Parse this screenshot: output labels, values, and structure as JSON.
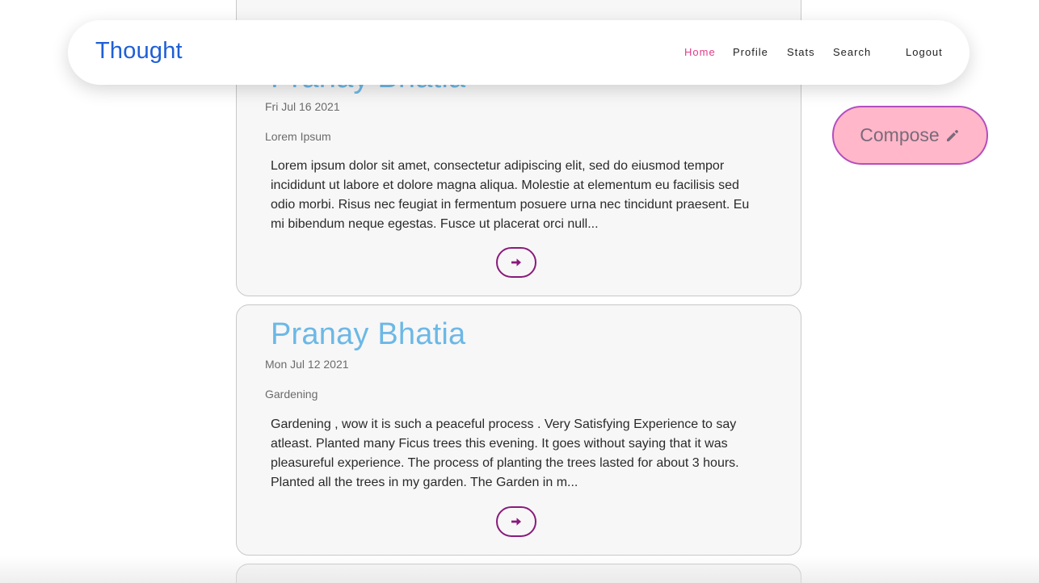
{
  "nav": {
    "brand": "Thought",
    "links": [
      {
        "label": "Home",
        "active": true
      },
      {
        "label": "Profile",
        "active": false
      },
      {
        "label": "Stats",
        "active": false
      },
      {
        "label": "Search",
        "active": false
      },
      {
        "label": "Logout",
        "active": false
      }
    ]
  },
  "compose": {
    "label": "Compose",
    "icon": "pencil-icon"
  },
  "posts": [
    {
      "author": "Pranay Bhatia",
      "date": "Fri Jul 16 2021",
      "title": "Lorem Ipsum",
      "body": "Lorem ipsum dolor sit amet, consectetur adipiscing elit, sed do eiusmod tempor incididunt ut labore et dolore magna aliqua. Molestie at elementum eu facilisis sed odio morbi. Risus nec feugiat in fermentum posuere urna nec tincidunt praesent. Eu mi bibendum neque egestas. Fusce ut placerat orci null..."
    },
    {
      "author": "Pranay Bhatia",
      "date": "Mon Jul 12 2021",
      "title": "Gardening",
      "body": "Gardening , wow it is such a peaceful process . Very Satisfying Experience to say atleast. Planted many Ficus trees this evening. It goes without saying that it was pleasureful experience. The process of planting the trees lasted for about 3 hours. Planted all the trees in my garden. The Garden in m..."
    }
  ],
  "icons": {
    "read_more": "arrow-right-icon"
  },
  "colors": {
    "brand": "#1e5fd6",
    "active_link": "#e23b8a",
    "author": "#6cb8e6",
    "button_border": "#8a1a7c",
    "compose_bg": "#ffb7c9",
    "compose_border": "#b44dbf"
  }
}
